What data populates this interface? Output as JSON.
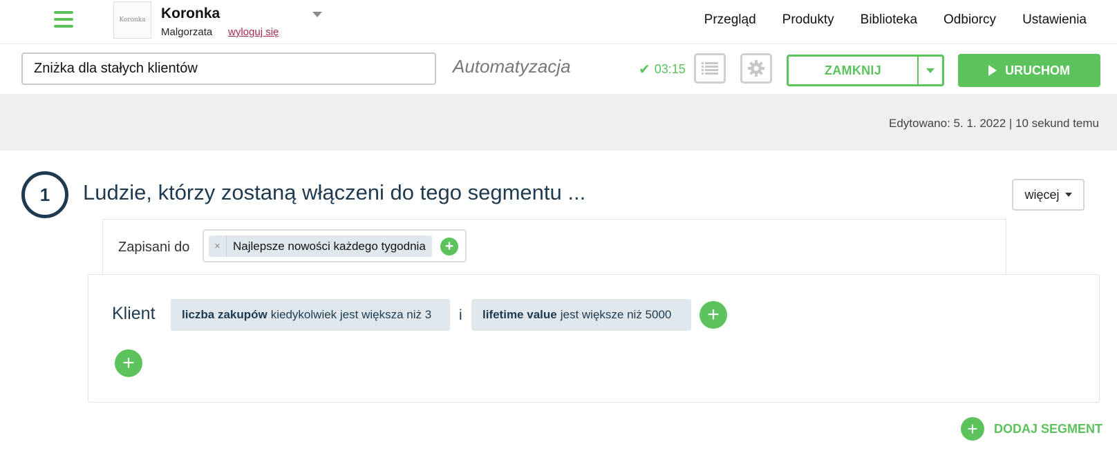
{
  "header": {
    "brand_logo_text": "Koronka",
    "brand_name": "Koronka",
    "user_name": "Malgorzata",
    "logout_label": "wyloguj się",
    "nav": [
      {
        "label": "Przegląd"
      },
      {
        "label": "Produkty"
      },
      {
        "label": "Biblioteka"
      },
      {
        "label": "Odbiorcy"
      },
      {
        "label": "Ustawienia"
      }
    ]
  },
  "toolbar": {
    "name_value": "Zniżka dla stałych klientów",
    "mode_label": "Automatyzacja",
    "timer": "03:15",
    "close_label": "ZAMKNIJ",
    "run_label": "URUCHOM"
  },
  "status": {
    "edited": "Edytowano: 5. 1. 2022 | 10 sekund temu"
  },
  "segment": {
    "step_number": "1",
    "title": "Ludzie, którzy zostaną włączeni do tego segmentu ...",
    "more_label": "więcej",
    "saved_label": "Zapisani do",
    "tags": [
      {
        "remove_glyph": "×",
        "label": "Najlepsze nowości każdego tygodnia"
      }
    ],
    "subject_label": "Klient",
    "conditions": [
      {
        "field": "liczba zakupów",
        "rule": "kiedykolwiek jest większa niż 3"
      },
      {
        "field": "lifetime value",
        "rule": "jest większe niż 5000"
      }
    ],
    "conjunction": "i"
  },
  "footer": {
    "add_segment_label": "DODAJ SEGMENT"
  },
  "colors": {
    "accent_green": "#5cc25c",
    "title_navy": "#1e3a50",
    "logout_link": "#a5294f"
  },
  "icons": [
    "hamburger-icon",
    "caret-down-icon",
    "checkmark-icon",
    "list-icon",
    "gear-icon",
    "play-icon",
    "plus-icon",
    "close-icon"
  ]
}
